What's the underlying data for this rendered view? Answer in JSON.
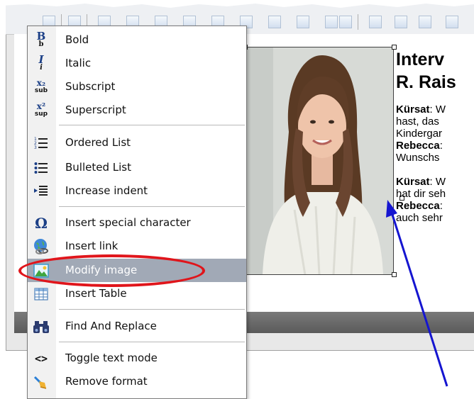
{
  "toolbar": {
    "icons": [
      "table-icon",
      "insert-row-icon",
      "insert-column-icon",
      "merge-cells-icon",
      "split-cells-icon",
      "delete-row-icon",
      "delete-column-icon",
      "cell-properties-icon",
      "table-properties-icon"
    ]
  },
  "document": {
    "title_line1": "Interv",
    "title_line2": "R. Rais",
    "lines": [
      {
        "bold": "Kürsat",
        "text": ": W"
      },
      {
        "bold": "",
        "text": "hast, das"
      },
      {
        "bold": "",
        "text": "Kindergar"
      },
      {
        "bold": "Rebecca",
        "text": ":"
      },
      {
        "bold": "",
        "text": "Wunschs"
      },
      {
        "bold": "",
        "text": ""
      },
      {
        "bold": "Kürsat",
        "text": ": W"
      },
      {
        "bold": "",
        "text": "hat dir seh"
      },
      {
        "bold": "Rebecca",
        "text": ":"
      },
      {
        "bold": "",
        "text": "auch sehr"
      }
    ]
  },
  "context_menu": {
    "items": [
      {
        "label": "Bold",
        "icon": "bold-icon"
      },
      {
        "label": "Italic",
        "icon": "italic-icon"
      },
      {
        "label": "Subscript",
        "icon": "subscript-icon"
      },
      {
        "label": "Superscript",
        "icon": "superscript-icon"
      },
      {
        "label": "Ordered List",
        "icon": "ordered-list-icon"
      },
      {
        "label": "Bulleted List",
        "icon": "bulleted-list-icon"
      },
      {
        "label": "Increase indent",
        "icon": "increase-indent-icon"
      },
      {
        "label": "Insert special character",
        "icon": "omega-icon"
      },
      {
        "label": "Insert link",
        "icon": "globe-link-icon"
      },
      {
        "label": "Modify image",
        "icon": "image-icon"
      },
      {
        "label": "Insert Table",
        "icon": "table-icon"
      },
      {
        "label": "Find And Replace",
        "icon": "binoculars-icon"
      },
      {
        "label": "Toggle text mode",
        "icon": "code-brackets-icon"
      },
      {
        "label": "Remove format",
        "icon": "eraser-broom-icon"
      }
    ],
    "highlighted_item": "Modify image"
  },
  "icon_glyphs": {
    "bold": "B",
    "bold_sub": "b",
    "italic": "I",
    "italic_sub": "i",
    "subscript": "x₂",
    "subscript_sub": "sub",
    "superscript": "x²",
    "superscript_sub": "sup",
    "omega": "Ω",
    "code": "<>"
  },
  "colors": {
    "menu_highlight": "#a1a9b6",
    "annotation_red": "#e0151b",
    "annotation_blue": "#1515d0",
    "icon_blue": "#1b3f86"
  }
}
